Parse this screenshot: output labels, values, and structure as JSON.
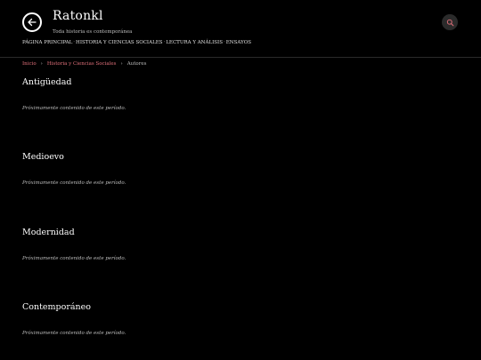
{
  "header": {
    "title": "Ratonkl",
    "subtitle": "Toda historia es contemporánea",
    "back_icon": "arrow-left-icon",
    "search_icon": "search-icon"
  },
  "nav": {
    "items": [
      "PÁGINA PRINCIPAL",
      "HISTORIA Y CIENCIAS SOCIALES",
      "LECTURA Y ANÁLISIS",
      "ENSAYOS"
    ],
    "separator": "·"
  },
  "breadcrumb": {
    "items": [
      "Inicio",
      "Historia y Ciencias Sociales",
      "Autores"
    ],
    "separator": "›"
  },
  "sections": [
    {
      "title": "Antigüedad",
      "text": "Próximamente contenido de este período."
    },
    {
      "title": "Medioevo",
      "text": "Próximamente contenido de este período."
    },
    {
      "title": "Modernidad",
      "text": "Próximamente contenido de este período."
    },
    {
      "title": "Contemporáneo",
      "text": "Próximamente contenido de este período."
    }
  ],
  "colors": {
    "background": "#000000",
    "link_accent": "#e0707a",
    "text": "#e6e6e6"
  }
}
